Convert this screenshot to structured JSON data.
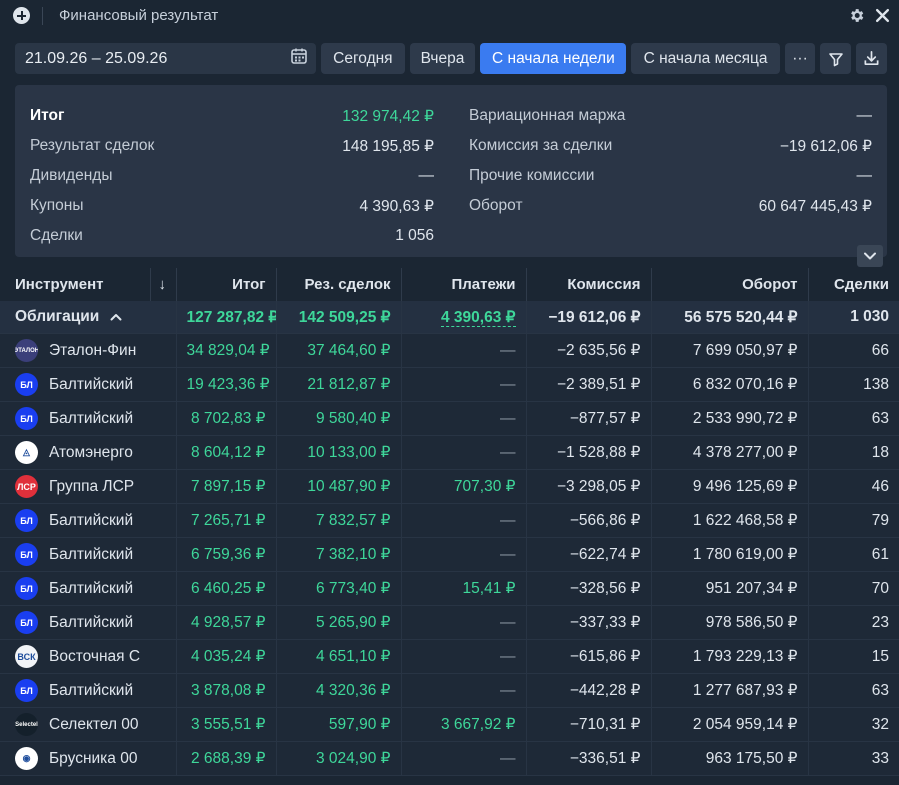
{
  "window": {
    "title": "Финансовый результат"
  },
  "icons": {
    "add": "plus-icon",
    "settings": "gear-icon",
    "close": "close-icon",
    "calendar": "calendar-icon",
    "more": "more-icon",
    "filter": "filter-icon",
    "download": "download-icon",
    "expand": "chevron-down-icon"
  },
  "toolbar": {
    "date_range": "21.09.26 – 25.09.26",
    "today": "Сегодня",
    "yesterday": "Вчера",
    "since_week": "С начала недели",
    "since_month": "С начала месяца",
    "more": "···"
  },
  "summary": {
    "left": [
      {
        "label": "Итог",
        "value": "132 974,42 ₽"
      },
      {
        "label": "Результат сделок",
        "value": "148 195,85 ₽"
      },
      {
        "label": "Дивиденды",
        "value": "—"
      },
      {
        "label": "Купоны",
        "value": "4 390,63 ₽"
      },
      {
        "label": "Сделки",
        "value": "1 056"
      }
    ],
    "right": [
      {
        "label": "Вариационная маржа",
        "value": "—"
      },
      {
        "label": "Комиссия за сделки",
        "value": "−19 612,06 ₽"
      },
      {
        "label": "Прочие комиссии",
        "value": "—"
      },
      {
        "label": "Оборот",
        "value": "60 647 445,43 ₽"
      }
    ]
  },
  "table": {
    "headers": {
      "instrument": "Инструмент",
      "sort": "↓",
      "total": "Итог",
      "deals_result": "Рез. сделок",
      "payments": "Платежи",
      "commission": "Комиссия",
      "turnover": "Оборот",
      "deals": "Сделки"
    },
    "group": {
      "name": "Облигации",
      "chevron": "^",
      "total": "127 287,82 ₽",
      "deals_result": "142 509,25 ₽",
      "payments": "4 390,63 ₽",
      "commission": "−19 612,06 ₽",
      "turnover": "56 575 520,44 ₽",
      "deals": "1 030"
    },
    "rows": [
      {
        "logo": "ЭТАЛОН",
        "logo_color": "#3b3f7a",
        "name": "Эталон-Фин",
        "total": "34 829,04 ₽",
        "deals_result": "37 464,60 ₽",
        "payments": "—",
        "commission": "−2 635,56 ₽",
        "turnover": "7 699 050,97 ₽",
        "deals": "66"
      },
      {
        "logo": "БЛ",
        "logo_color": "#1a3ef0",
        "name": "Балтийский",
        "total": "19 423,36 ₽",
        "deals_result": "21 812,87 ₽",
        "payments": "—",
        "commission": "−2 389,51 ₽",
        "turnover": "6 832 070,16 ₽",
        "deals": "138"
      },
      {
        "logo": "БЛ",
        "logo_color": "#1a3ef0",
        "name": "Балтийский",
        "total": "8 702,83 ₽",
        "deals_result": "9 580,40 ₽",
        "payments": "—",
        "commission": "−877,57 ₽",
        "turnover": "2 533 990,72 ₽",
        "deals": "63"
      },
      {
        "logo": "◬",
        "logo_color": "#ffffff",
        "name": "Атомэнерго",
        "total": "8 604,12 ₽",
        "deals_result": "10 133,00 ₽",
        "payments": "—",
        "commission": "−1 528,88 ₽",
        "turnover": "4 378 277,00 ₽",
        "deals": "18"
      },
      {
        "logo": "ЛСР",
        "logo_color": "#e0303b",
        "name": "Группа ЛСР",
        "total": "7 897,15 ₽",
        "deals_result": "10 487,90 ₽",
        "payments": "707,30 ₽",
        "commission": "−3 298,05 ₽",
        "turnover": "9 496 125,69 ₽",
        "deals": "46"
      },
      {
        "logo": "БЛ",
        "logo_color": "#1a3ef0",
        "name": "Балтийский",
        "total": "7 265,71 ₽",
        "deals_result": "7 832,57 ₽",
        "payments": "—",
        "commission": "−566,86 ₽",
        "turnover": "1 622 468,58 ₽",
        "deals": "79"
      },
      {
        "logo": "БЛ",
        "logo_color": "#1a3ef0",
        "name": "Балтийский",
        "total": "6 759,36 ₽",
        "deals_result": "7 382,10 ₽",
        "payments": "—",
        "commission": "−622,74 ₽",
        "turnover": "1 780 619,00 ₽",
        "deals": "61"
      },
      {
        "logo": "БЛ",
        "logo_color": "#1a3ef0",
        "name": "Балтийский",
        "total": "6 460,25 ₽",
        "deals_result": "6 773,40 ₽",
        "payments": "15,41 ₽",
        "commission": "−328,56 ₽",
        "turnover": "951 207,34 ₽",
        "deals": "70"
      },
      {
        "logo": "БЛ",
        "logo_color": "#1a3ef0",
        "name": "Балтийский",
        "total": "4 928,57 ₽",
        "deals_result": "5 265,90 ₽",
        "payments": "—",
        "commission": "−337,33 ₽",
        "turnover": "978 586,50 ₽",
        "deals": "23"
      },
      {
        "logo": "ВСК",
        "logo_color": "#f2f4f7",
        "name": "Восточная С",
        "total": "4 035,24 ₽",
        "deals_result": "4 651,10 ₽",
        "payments": "—",
        "commission": "−615,86 ₽",
        "turnover": "1 793 229,13 ₽",
        "deals": "15"
      },
      {
        "logo": "БЛ",
        "logo_color": "#1a3ef0",
        "name": "Балтийский",
        "total": "3 878,08 ₽",
        "deals_result": "4 320,36 ₽",
        "payments": "—",
        "commission": "−442,28 ₽",
        "turnover": "1 277 687,93 ₽",
        "deals": "63"
      },
      {
        "logo": "Selectel",
        "logo_color": "#14202b",
        "name": "Селектел 00",
        "total": "3 555,51 ₽",
        "deals_result": "597,90 ₽",
        "payments": "3 667,92 ₽",
        "commission": "−710,31 ₽",
        "turnover": "2 054 959,14 ₽",
        "deals": "32"
      },
      {
        "logo": "◉",
        "logo_color": "#ffffff",
        "name": "Брусника 00",
        "total": "2 688,39 ₽",
        "deals_result": "3 024,90 ₽",
        "payments": "—",
        "commission": "−336,51 ₽",
        "turnover": "963 175,50 ₽",
        "deals": "33"
      }
    ]
  }
}
